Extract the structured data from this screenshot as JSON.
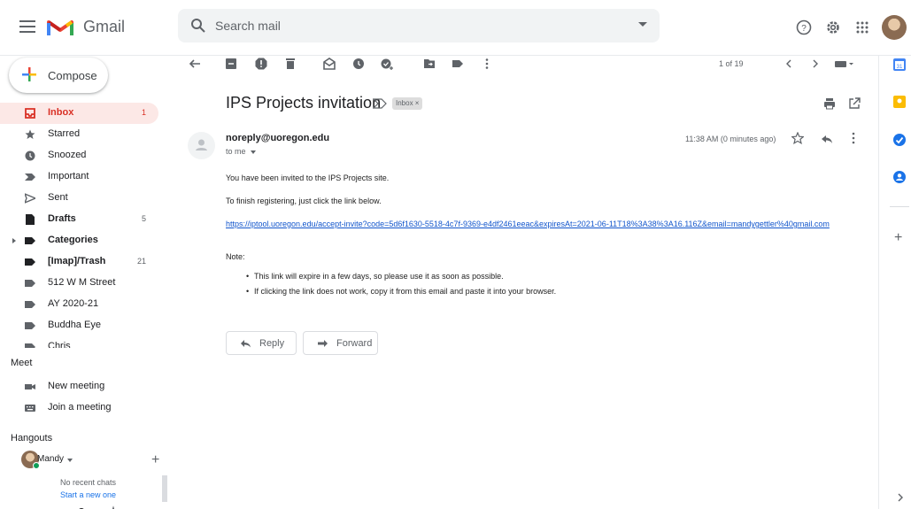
{
  "app": {
    "brand": "Gmail"
  },
  "search": {
    "placeholder": "Search mail"
  },
  "compose": {
    "label": "Compose"
  },
  "sidebar": {
    "items": [
      {
        "label": "Inbox",
        "count": "1",
        "icon": "inbox-icon"
      },
      {
        "label": "Starred",
        "count": "",
        "icon": "star-icon"
      },
      {
        "label": "Snoozed",
        "count": "",
        "icon": "clock-icon"
      },
      {
        "label": "Important",
        "count": "",
        "icon": "important-icon"
      },
      {
        "label": "Sent",
        "count": "",
        "icon": "send-icon"
      },
      {
        "label": "Drafts",
        "count": "5",
        "icon": "draft-icon"
      },
      {
        "label": "Categories",
        "count": "",
        "icon": "label-icon"
      },
      {
        "label": "[Imap]/Trash",
        "count": "21",
        "icon": "label-icon"
      },
      {
        "label": "512 W M Street",
        "count": "",
        "icon": "label-icon"
      },
      {
        "label": "AY 2020-21",
        "count": "",
        "icon": "label-icon"
      },
      {
        "label": "Buddha Eye",
        "count": "",
        "icon": "label-icon"
      },
      {
        "label": "Chris",
        "count": "",
        "icon": "label-icon"
      }
    ]
  },
  "meet": {
    "title": "Meet",
    "new_meeting": "New meeting",
    "join_meeting": "Join a meeting"
  },
  "hangouts": {
    "title": "Hangouts",
    "user": "Mandy",
    "no_chats": "No recent chats",
    "start_new": "Start a new one"
  },
  "toolbar": {
    "page_count": "1 of 19"
  },
  "message": {
    "subject": "IPS Projects invitation",
    "label": "Inbox ×",
    "sender": "noreply@uoregon.edu",
    "to": "to me",
    "time": "11:38 AM (0 minutes ago)",
    "line1": "You have been invited to the IPS Projects site.",
    "line2": "To finish registering, just click the link below.",
    "link": "https://iptool.uoregon.edu/accept-invite?code=5d6f1630-5518-4c7f-9369-e4df2461eeac&expiresAt=2021-06-11T18%3A38%3A16.116Z&email=mandygettler%40gmail.com",
    "note": "Note:",
    "bullet1": "This link will expire in a few days, so please use it as soon as possible.",
    "bullet2": "If clicking the link does not work, copy it from this email and paste it into your browser."
  },
  "actions": {
    "reply": "Reply",
    "forward": "Forward"
  },
  "colors": {
    "accent_red": "#d93025",
    "inbox_bg": "#fce8e6",
    "link_blue": "#1155cc"
  }
}
